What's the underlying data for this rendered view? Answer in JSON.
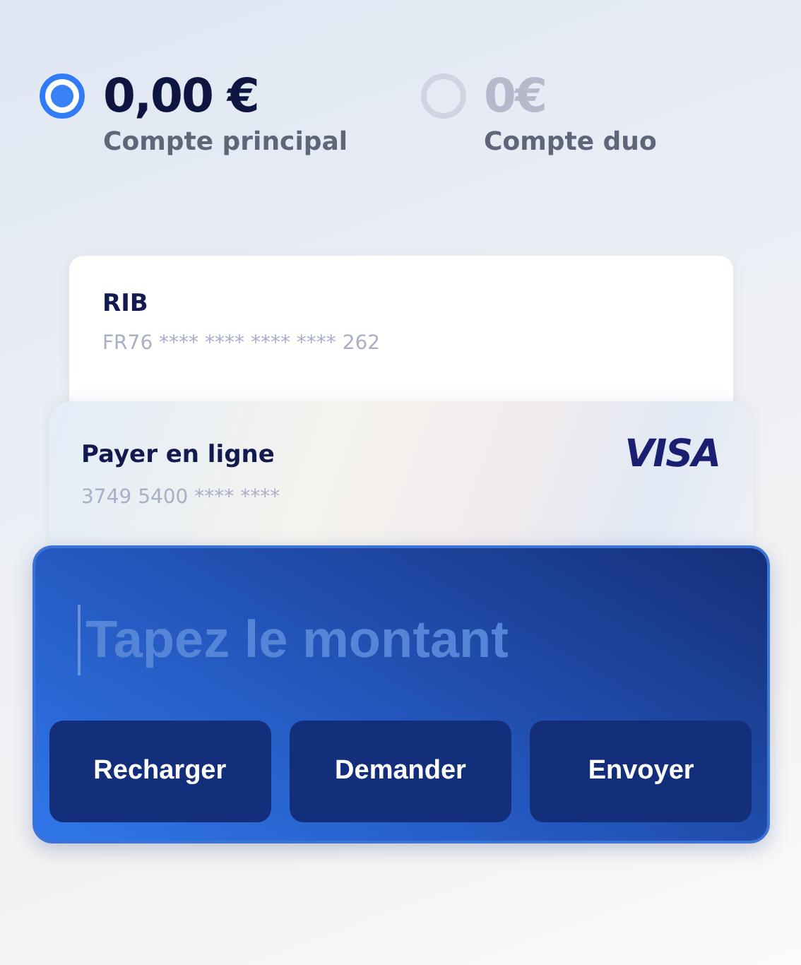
{
  "accounts": [
    {
      "amount": "0,00 €",
      "label": "Compte principal",
      "selected": true
    },
    {
      "amount": "0€",
      "label": "Compte duo",
      "selected": false
    }
  ],
  "cards": [
    {
      "kind": "rib",
      "title": "RIB",
      "number": "FR76 **** **** **** **** 262"
    },
    {
      "kind": "card",
      "title": "Payer en ligne",
      "number": "3749 5400 **** ****",
      "brand": "VISA"
    }
  ],
  "amount_field": {
    "placeholder": "Tapez le montant"
  },
  "buttons": [
    "Recharger",
    "Demander",
    "Envoyer"
  ]
}
